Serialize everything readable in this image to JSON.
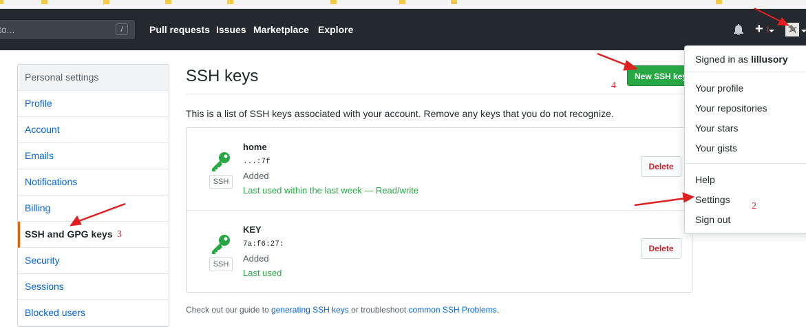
{
  "header": {
    "search_placeholder": "to...",
    "slash_hint": "/",
    "nav": [
      "Pull requests",
      "Issues",
      "Marketplace",
      "Explore"
    ],
    "plus_label": "+"
  },
  "sidebar": {
    "heading": "Personal settings",
    "items": [
      {
        "label": "Profile"
      },
      {
        "label": "Account"
      },
      {
        "label": "Emails"
      },
      {
        "label": "Notifications"
      },
      {
        "label": "Billing"
      },
      {
        "label": "SSH and GPG keys"
      },
      {
        "label": "Security"
      },
      {
        "label": "Sessions"
      },
      {
        "label": "Blocked users"
      }
    ]
  },
  "main": {
    "title": "SSH keys",
    "new_button": "New SSH key",
    "description": "This is a list of SSH keys associated with your account. Remove any keys that you do not recognize.",
    "keys": [
      {
        "badge": "SSH",
        "title": "home",
        "fingerprint": "...:7f",
        "added": "Added",
        "last_used": "Last used within the last week — Read/write",
        "delete": "Delete"
      },
      {
        "badge": "SSH",
        "title": "KEY",
        "fingerprint": "7a:f6:27:",
        "added": "Added",
        "last_used": "Last used",
        "delete": "Delete"
      }
    ],
    "footer": {
      "prefix": "Check out our guide to ",
      "link1": "generating SSH keys",
      "middle": " or troubleshoot ",
      "link2": "common SSH Problems",
      "suffix": "."
    }
  },
  "dropdown": {
    "signed_in_prefix": "Signed in as ",
    "username": "lillusory",
    "items": [
      "Your profile",
      "Your repositories",
      "Your stars",
      "Your gists",
      "Help",
      "Settings",
      "Sign out"
    ]
  },
  "annotations": {
    "one": "1",
    "two": "2",
    "three": "3",
    "four": "4"
  }
}
